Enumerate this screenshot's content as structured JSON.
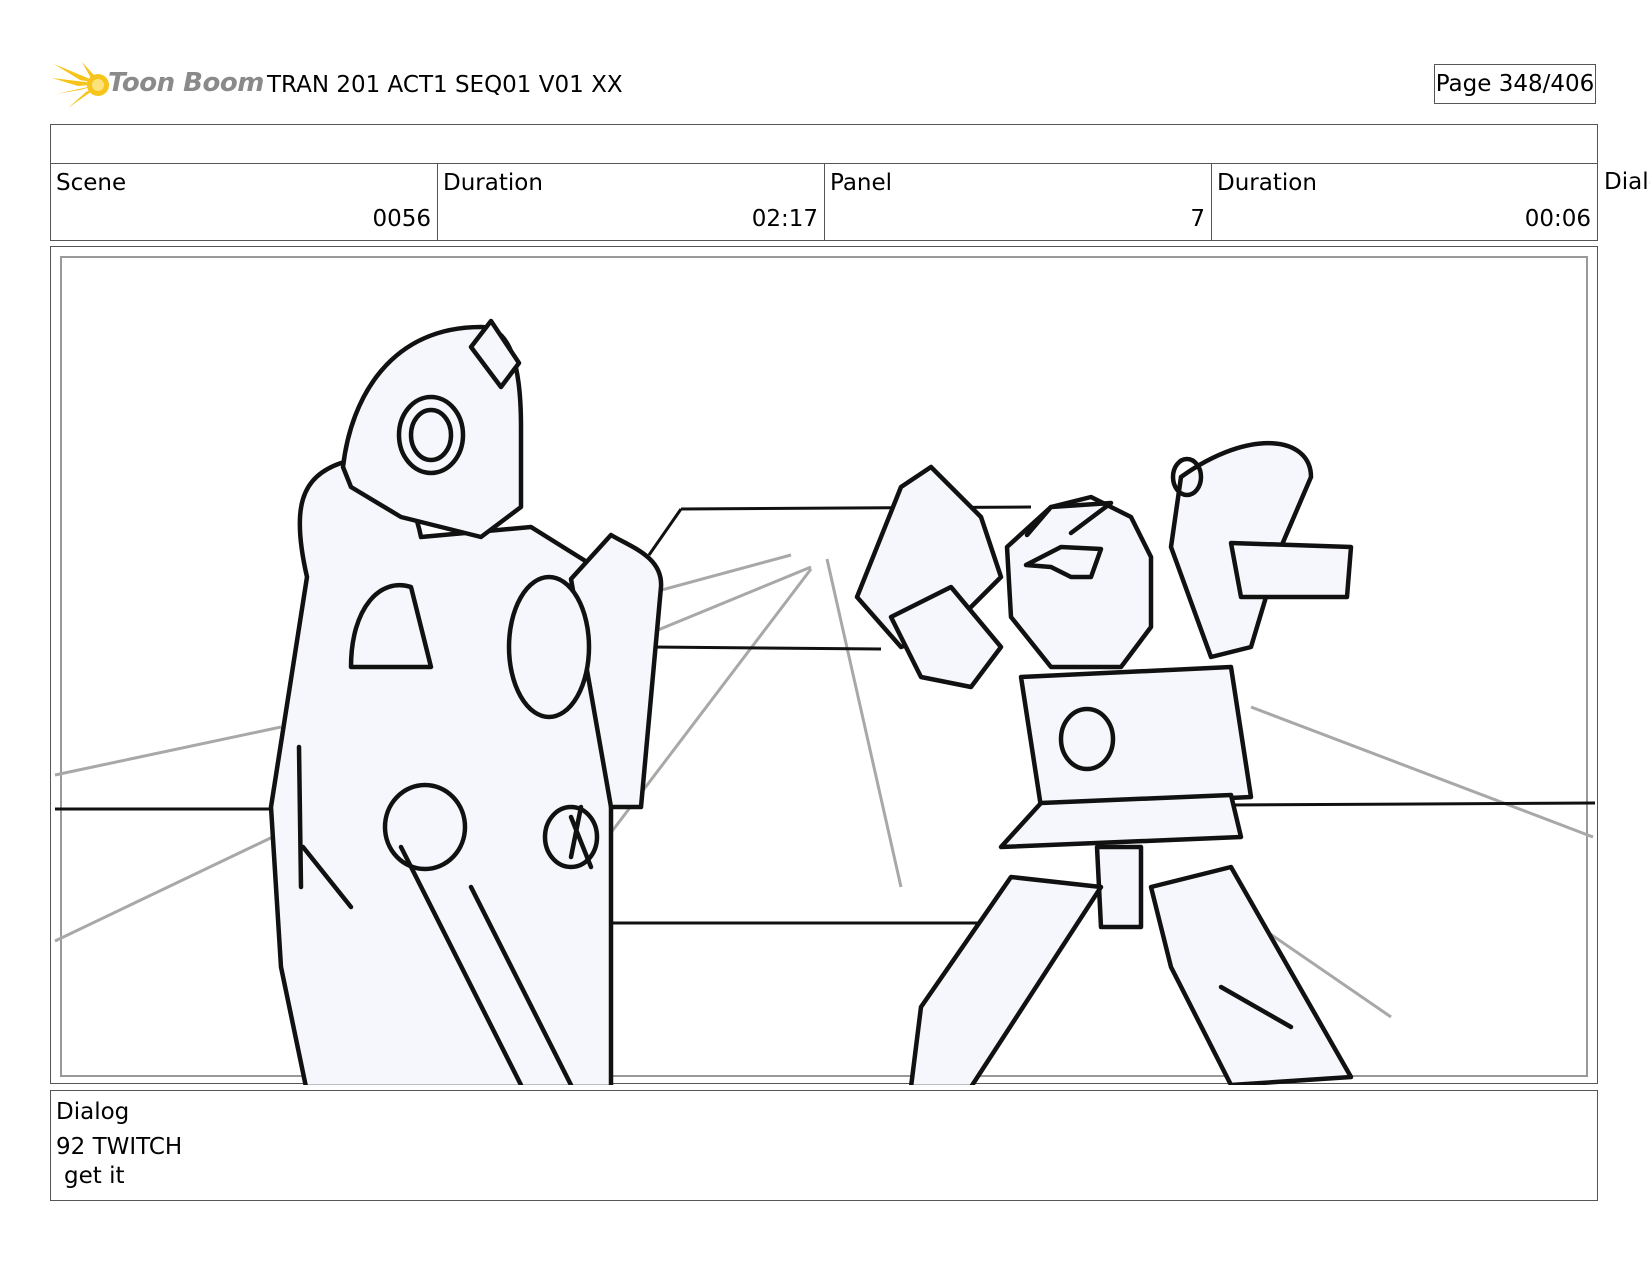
{
  "header": {
    "logo_text": "Toon Boom",
    "title": "TRAN 201 ACT1 SEQ01 V01 XX",
    "page": "Page 348/406"
  },
  "info": {
    "scene_label": "Scene",
    "scene_value": "0056",
    "scene_duration_label": "Duration",
    "scene_duration_value": "02:17",
    "panel_label": "Panel",
    "panel_value": "7",
    "panel_duration_label": "Duration",
    "panel_duration_value": "00:06",
    "overflow_label": "Dialo"
  },
  "dialog": {
    "label": "Dialog",
    "speaker": "92 TWITCH",
    "line": "get it"
  },
  "colors": {
    "logo_yellow": "#f6c41a",
    "sketch_line": "#111111",
    "guide_line": "#a8a8a8",
    "fill": "#f5f7fc"
  }
}
